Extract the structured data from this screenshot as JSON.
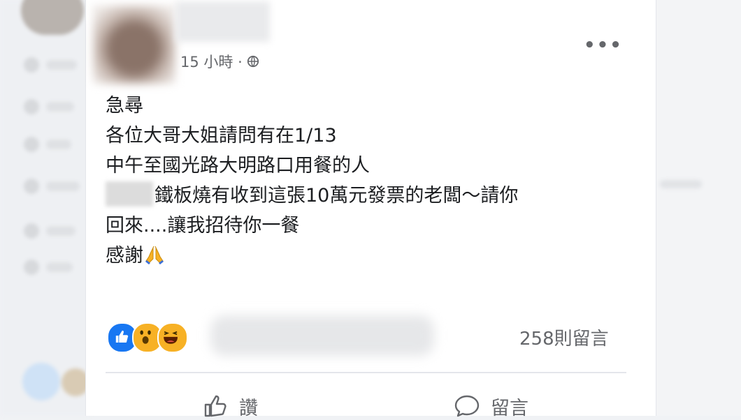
{
  "post": {
    "timestamp": "15 小時 ·",
    "more_label": "•••",
    "lines": [
      "急尋",
      "各位大哥大姐請問有在1/13",
      "中午至國光路大明路口用餐的人",
      "鐵板燒有收到這張10萬元發票的老闆～請你",
      "回來....讓我招待你一餐",
      "感謝"
    ],
    "comment_count": "258則留言"
  },
  "actions": {
    "like_label": "讚",
    "comment_label": "留言"
  },
  "colors": {
    "like_blue": "#1877f2",
    "emoji_yellow": "#f7b125",
    "secondary_text": "#65676b"
  }
}
